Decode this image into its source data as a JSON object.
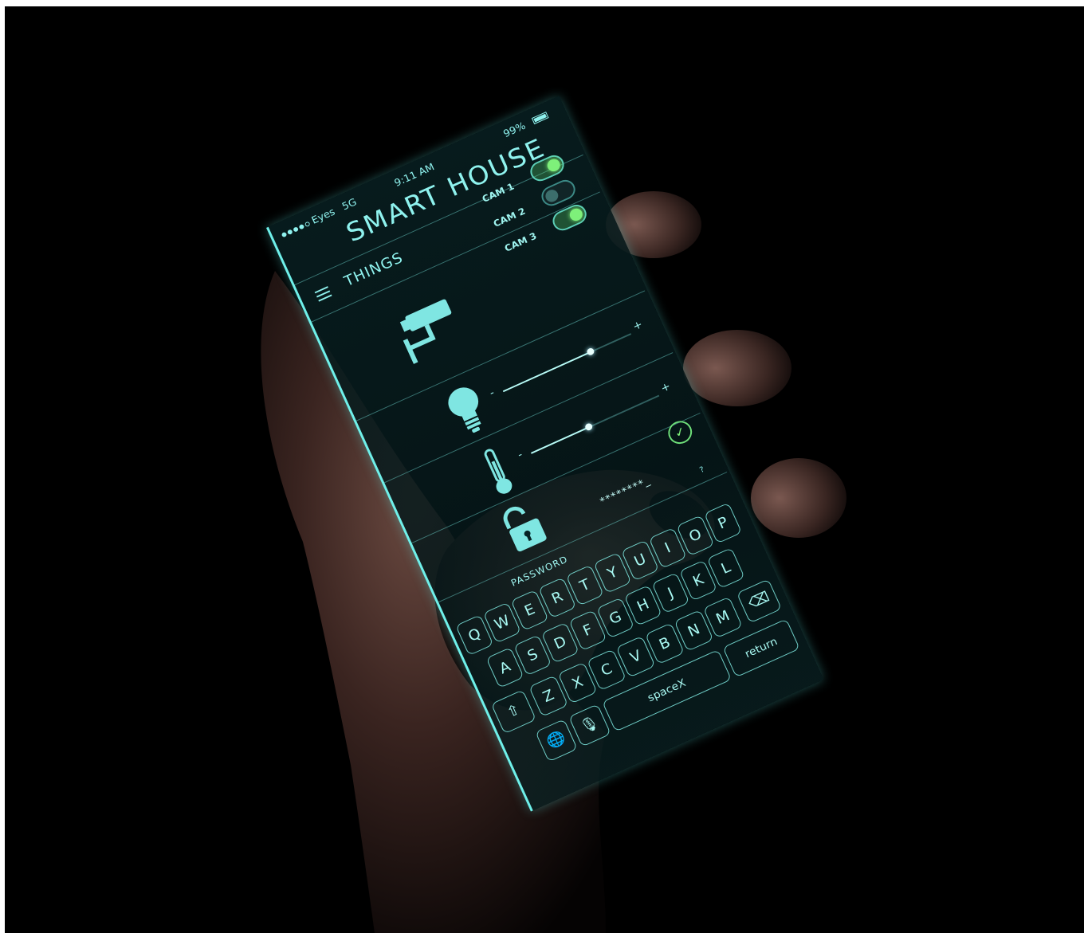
{
  "status_bar": {
    "carrier": "Eyes",
    "network": "5G",
    "time": "9:11 AM",
    "battery": "99%"
  },
  "header": {
    "title": "SMART HOUSE"
  },
  "nav": {
    "section": "THINGS",
    "menu_icon": "hamburger-icon"
  },
  "cameras": [
    {
      "label": "CAM 1",
      "on": true
    },
    {
      "label": "CAM 2",
      "on": false
    },
    {
      "label": "CAM 3",
      "on": true
    }
  ],
  "devices": [
    {
      "name": "camera",
      "icon": "security-camera-icon"
    },
    {
      "name": "light",
      "icon": "light-bulb-icon",
      "level": 0.68,
      "minus": "-",
      "plus": "+"
    },
    {
      "name": "temperature",
      "icon": "thermometer-icon",
      "level": 0.45,
      "minus": "-",
      "plus": "+"
    },
    {
      "name": "lock",
      "icon": "unlocked-padlock-icon"
    }
  ],
  "password": {
    "label": "PASSWORD",
    "value": "********_",
    "help": "?",
    "confirm_icon": "check-icon"
  },
  "keyboard": {
    "row1": [
      "Q",
      "W",
      "E",
      "R",
      "T",
      "Y",
      "U",
      "I",
      "O",
      "P"
    ],
    "row2": [
      "A",
      "S",
      "D",
      "F",
      "G",
      "H",
      "J",
      "K",
      "L"
    ],
    "row3": [
      "Z",
      "X",
      "C",
      "V",
      "B",
      "N",
      "M"
    ],
    "shift_icon": "shift-icon",
    "backspace_icon": "backspace-icon",
    "globe_icon": "globe-icon",
    "mic_icon": "microphone-icon",
    "space": "spaceX",
    "return": "return"
  },
  "colors": {
    "background": "#000000",
    "glow": "#7fe6e2",
    "toggle_on": "#7ef07a"
  }
}
